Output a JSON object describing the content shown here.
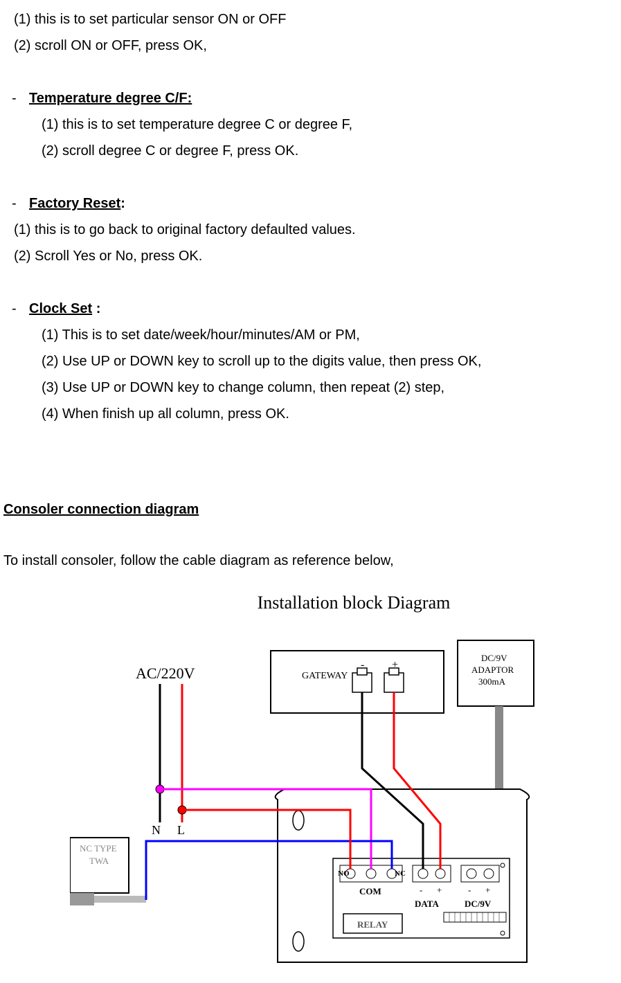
{
  "intro": {
    "line1": "(1) this is to set particular sensor ON or OFF",
    "line2": "(2) scroll ON or OFF, press OK,"
  },
  "sections": {
    "temp": {
      "title": "Temperature degree C/F:",
      "items": [
        "(1) this is to set temperature degree C or degree F,",
        "(2) scroll degree C or degree F, press OK."
      ]
    },
    "factory": {
      "title": "Factory Reset",
      "title_suffix": ":",
      "items": [
        "(1) this is to go back to original factory defaulted values.",
        "(2) Scroll Yes or No, press OK."
      ]
    },
    "clock": {
      "title": "Clock Set",
      "title_suffix": " :",
      "items": [
        "(1) This is to set date/week/hour/minutes/AM or PM,",
        "(2) Use UP or DOWN key to scroll up to the digits value, then press OK,",
        "(3) Use UP or DOWN key to change column, then repeat (2) step,",
        "(4) When finish up all column, press OK."
      ]
    }
  },
  "connection": {
    "heading": "Consoler connection diagram",
    "description": "To install consoler, follow the cable diagram as reference below,"
  },
  "diagram": {
    "title": "Installation block Diagram",
    "labels": {
      "ac": "AC/220V",
      "nc_type": "NC TYPE",
      "twa": "TWA",
      "n": "N",
      "l": "L",
      "gateway": "GATEWAY",
      "adaptor_line1": "DC/9V",
      "adaptor_line2": "ADAPTOR",
      "adaptor_line3": "300mA",
      "no": "NO",
      "nc": "NC",
      "com": "COM",
      "data": "DATA",
      "dc9v": "DC/9V",
      "relay": "RELAY",
      "minus": "-",
      "plus": "+"
    }
  }
}
